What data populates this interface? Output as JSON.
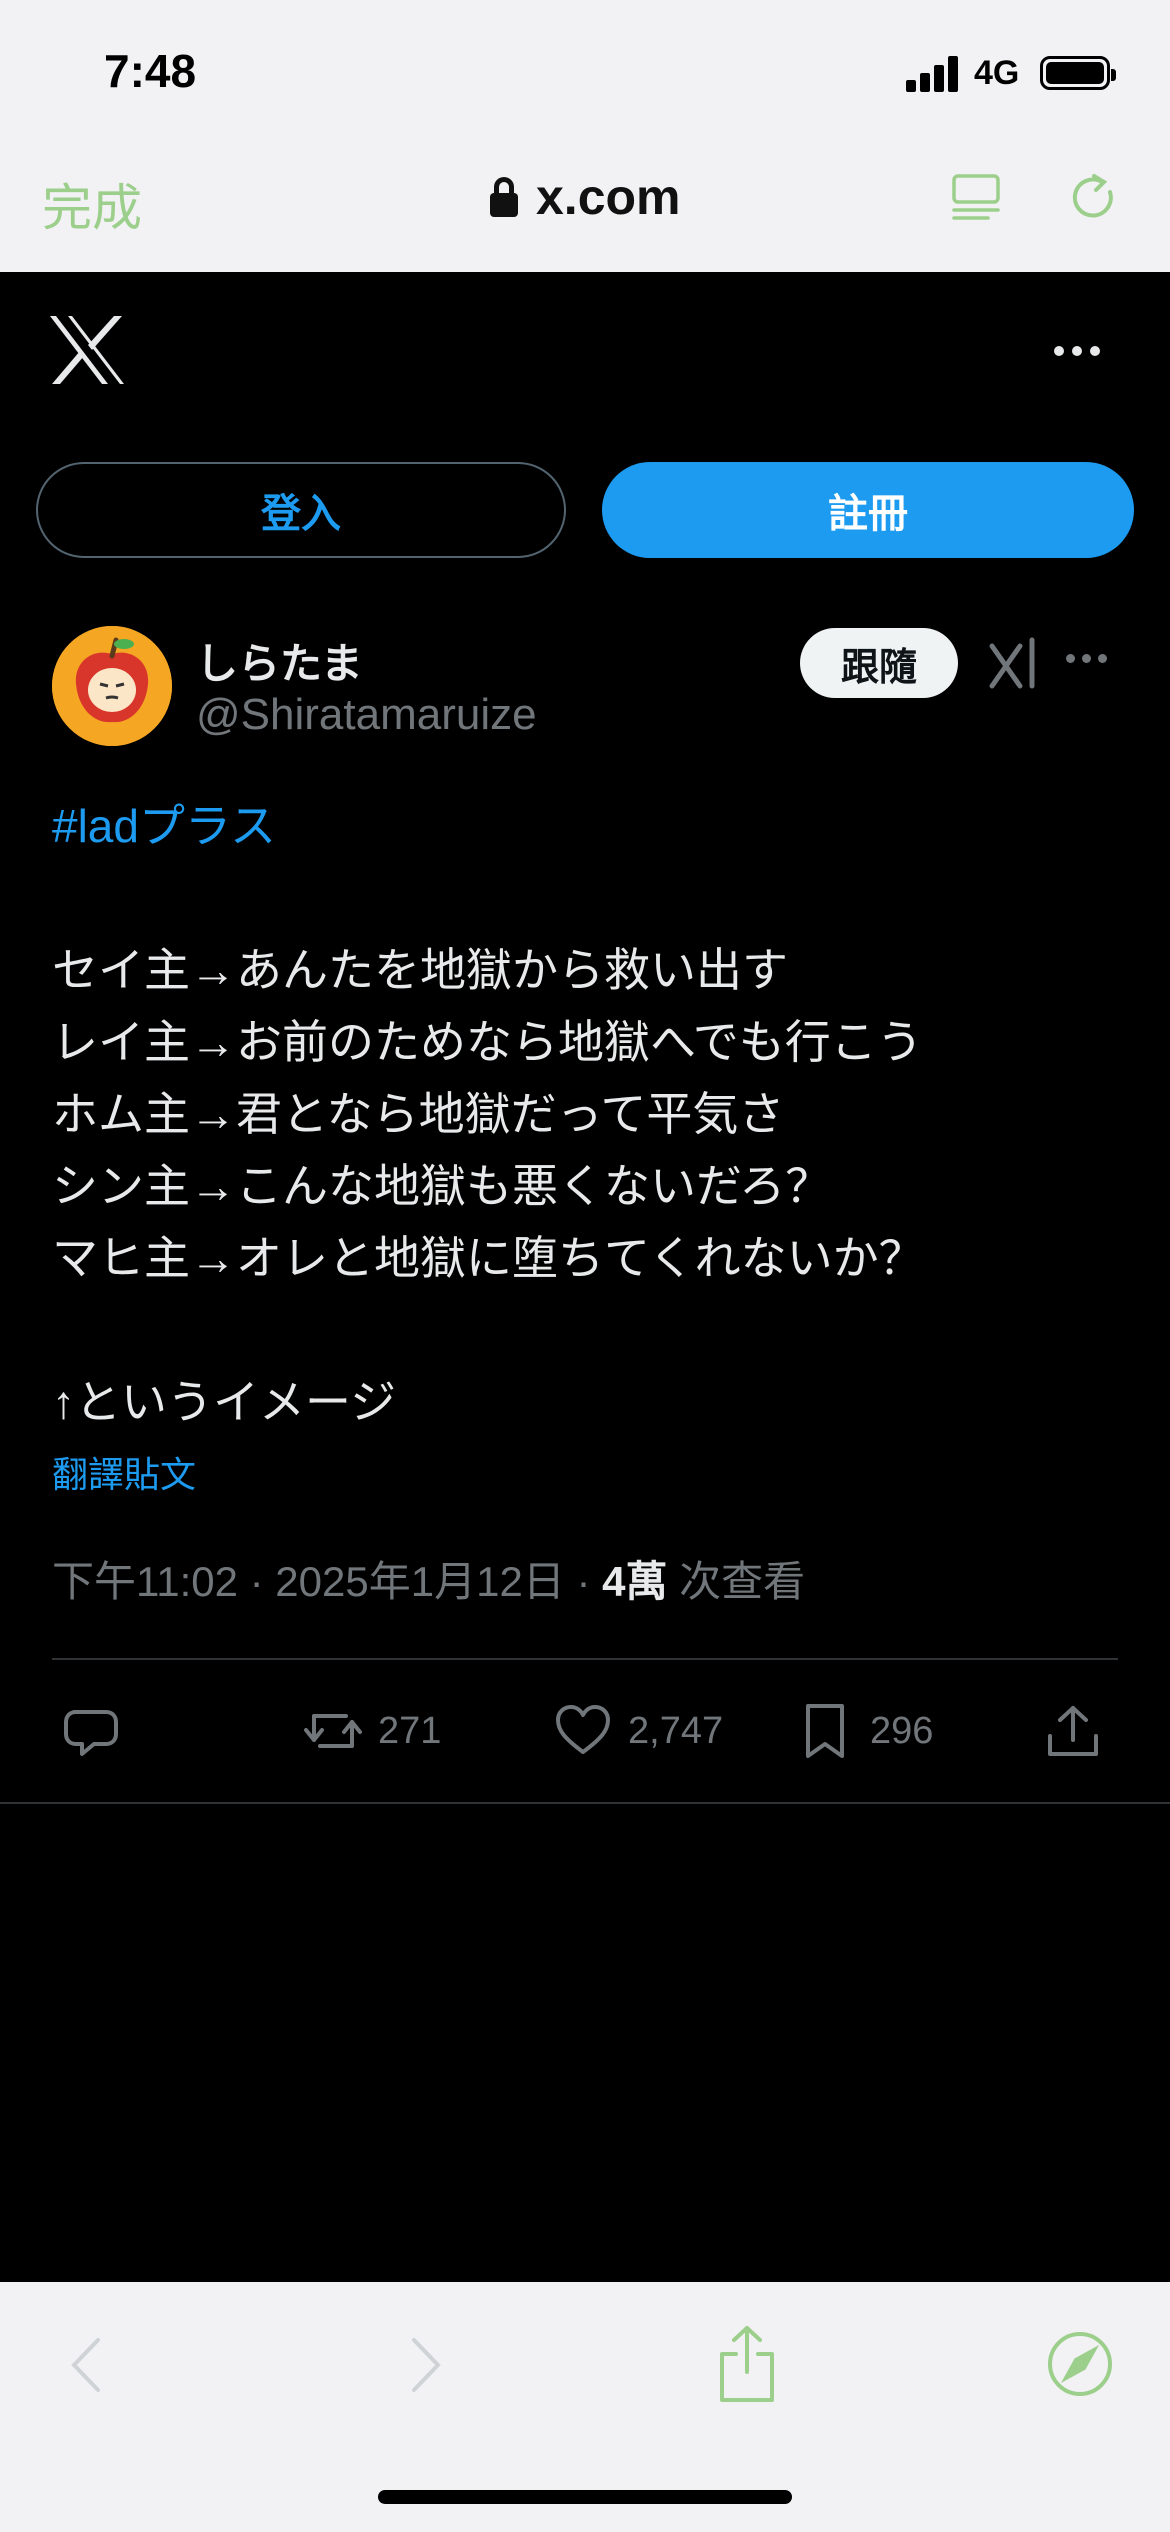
{
  "status_bar": {
    "time": "7:48",
    "network": "4G",
    "signal_icon": "cellular-signal-icon",
    "battery_icon": "battery-icon"
  },
  "browser": {
    "done_label": "完成",
    "url": "x.com",
    "accent_color": "#9ccf8b"
  },
  "x_header": {
    "logo_icon": "x-logo-icon",
    "more_icon": "more-icon"
  },
  "auth": {
    "login_label": "登入",
    "signup_label": "註冊"
  },
  "post": {
    "author_name": "しらたま",
    "author_handle": "@Shiratamaruize",
    "follow_label": "跟隨",
    "hashtag": "#ladプラス",
    "lines": [
      "セイ主→あんたを地獄から救い出す",
      "レイ主→お前のためなら地獄へでも行こう",
      "ホム主→君となら地獄だって平気さ",
      "シン主→こんな地獄も悪くないだろ？",
      "マヒ主→オレと地獄に堕ちてくれないか？"
    ],
    "closing": "↑というイメージ",
    "translate_label": "翻譯貼文",
    "timestamp": "下午11:02 · 2025年1月12日 · ",
    "views_count": "4萬",
    "views_label": " 次查看",
    "reposts": "271",
    "likes": "2,747",
    "bookmarks": "296"
  },
  "colors": {
    "link_blue": "#1d9bf0",
    "text_primary": "#e7e9ea",
    "text_secondary": "#71767b"
  }
}
